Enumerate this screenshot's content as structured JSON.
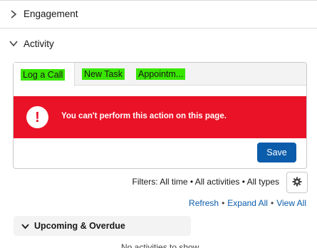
{
  "sections": {
    "engagement_label": "Engagement",
    "activity_label": "Activity"
  },
  "tabs": [
    {
      "label": "Log a Call",
      "active": true
    },
    {
      "label": "New Task",
      "active": false
    },
    {
      "label": "Appointm...",
      "active": false
    }
  ],
  "error": {
    "icon": "exclamation-icon",
    "message": "You can't perform this action on this page."
  },
  "save_label": "Save",
  "filters_text": "Filters: All time • All activities • All types",
  "links": {
    "refresh": "Refresh",
    "expand_all": "Expand All",
    "view_all": "View All",
    "separator": "•"
  },
  "upcoming_label": "Upcoming & Overdue",
  "no_activities_text": "No activities to show.",
  "colors": {
    "error_bg": "#ea1226",
    "brand_button": "#0b5cab",
    "link": "#0b5cab",
    "tab_highlight": "#39e600"
  }
}
